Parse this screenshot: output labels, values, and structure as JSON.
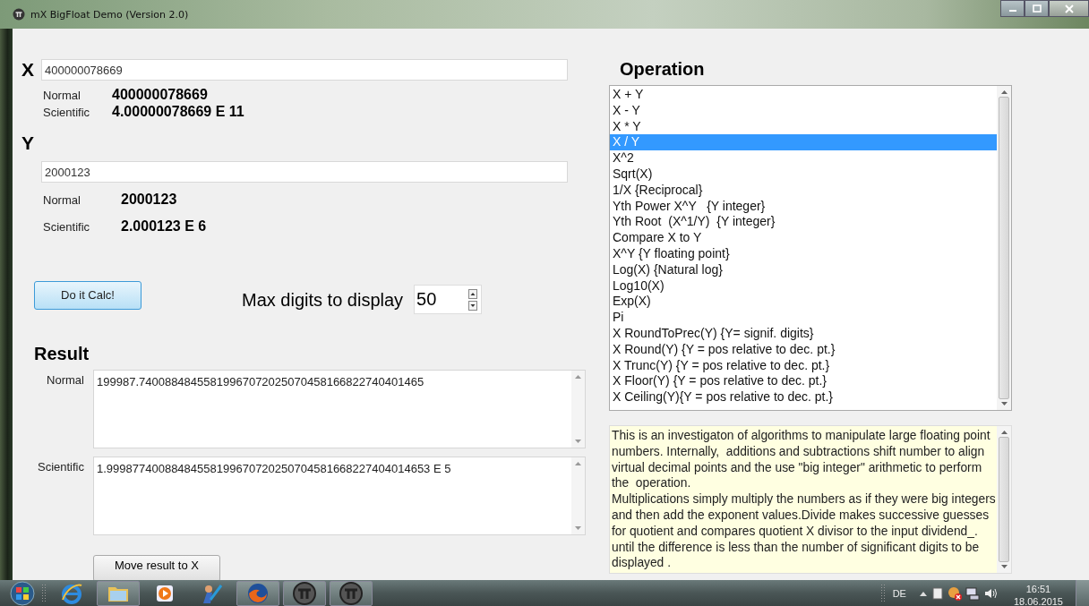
{
  "window": {
    "title": "mX BigFloat Demo (Version 2.0)"
  },
  "x": {
    "label": "X",
    "value": "400000078669",
    "normal_label": "Normal",
    "normal": "400000078669",
    "scientific_label": "Scientific",
    "scientific": "4.00000078669 E 11"
  },
  "y": {
    "label": "Y",
    "value": "2000123",
    "normal_label": "Normal",
    "normal": "2000123",
    "scientific_label": "Scientific",
    "scientific": "2.000123 E 6"
  },
  "calc_button": "Do it Calc!",
  "max_digits": {
    "label": "Max digits to display",
    "value": "50"
  },
  "result": {
    "heading": "Result",
    "normal_label": "Normal",
    "normal": "199987.74008848455819967072025070458166822740401465",
    "scientific_label": "Scientific",
    "scientific": "1.99987740088484558199670720250704581668227404014653 E 5"
  },
  "move_button": "Move result to X",
  "operation": {
    "heading": "Operation",
    "items": [
      {
        "label": "X + Y",
        "selected": false
      },
      {
        "label": "X - Y",
        "selected": false
      },
      {
        "label": "X * Y",
        "selected": false
      },
      {
        "label": "X / Y",
        "selected": true
      },
      {
        "label": "X^2",
        "selected": false
      },
      {
        "label": "Sqrt(X)",
        "selected": false
      },
      {
        "label": "1/X {Reciprocal}",
        "selected": false
      },
      {
        "label": "Yth Power X^Y   {Y integer}",
        "selected": false
      },
      {
        "label": "Yth Root  (X^1/Y)  {Y integer}",
        "selected": false
      },
      {
        "label": "Compare X to Y",
        "selected": false
      },
      {
        "label": "X^Y {Y floating point}",
        "selected": false
      },
      {
        "label": "Log(X) {Natural log}",
        "selected": false
      },
      {
        "label": "Log10(X)",
        "selected": false
      },
      {
        "label": "Exp(X)",
        "selected": false
      },
      {
        "label": "Pi",
        "selected": false
      },
      {
        "label": "X RoundToPrec(Y) {Y= signif. digits}",
        "selected": false
      },
      {
        "label": "X Round(Y) {Y = pos relative to dec. pt.}",
        "selected": false
      },
      {
        "label": "X Trunc(Y) {Y = pos relative to dec. pt.}",
        "selected": false
      },
      {
        "label": "X Floor(Y) {Y = pos relative to dec. pt.}",
        "selected": false
      },
      {
        "label": "X Ceiling(Y){Y = pos relative to dec. pt.}",
        "selected": false
      }
    ]
  },
  "description": [
    "This is an investigaton of algorithms to manipulate large floating point numbers. Internally,  additions and subtractions shift number to align virtual decimal points and the use \"big integer\" arithmetic to perform the  operation.",
    "Multiplications simply multiply the numbers as if they were big integers and then add the exponent values.Divide makes successive guesses for quotient and compares quotient X divisor to the input dividend_. until the difference is less than the number of significant digits to be displayed ."
  ],
  "taskbar": {
    "apps": [
      {
        "kind": "ie",
        "running": false
      },
      {
        "kind": "folder",
        "running": true
      },
      {
        "kind": "media",
        "running": false
      },
      {
        "kind": "tool",
        "running": false
      },
      {
        "kind": "firefox",
        "running": true
      },
      {
        "kind": "pi",
        "running": true
      },
      {
        "kind": "pi",
        "running": true
      }
    ],
    "language": "DE",
    "time": "16:51",
    "date": "18.06.2015"
  }
}
